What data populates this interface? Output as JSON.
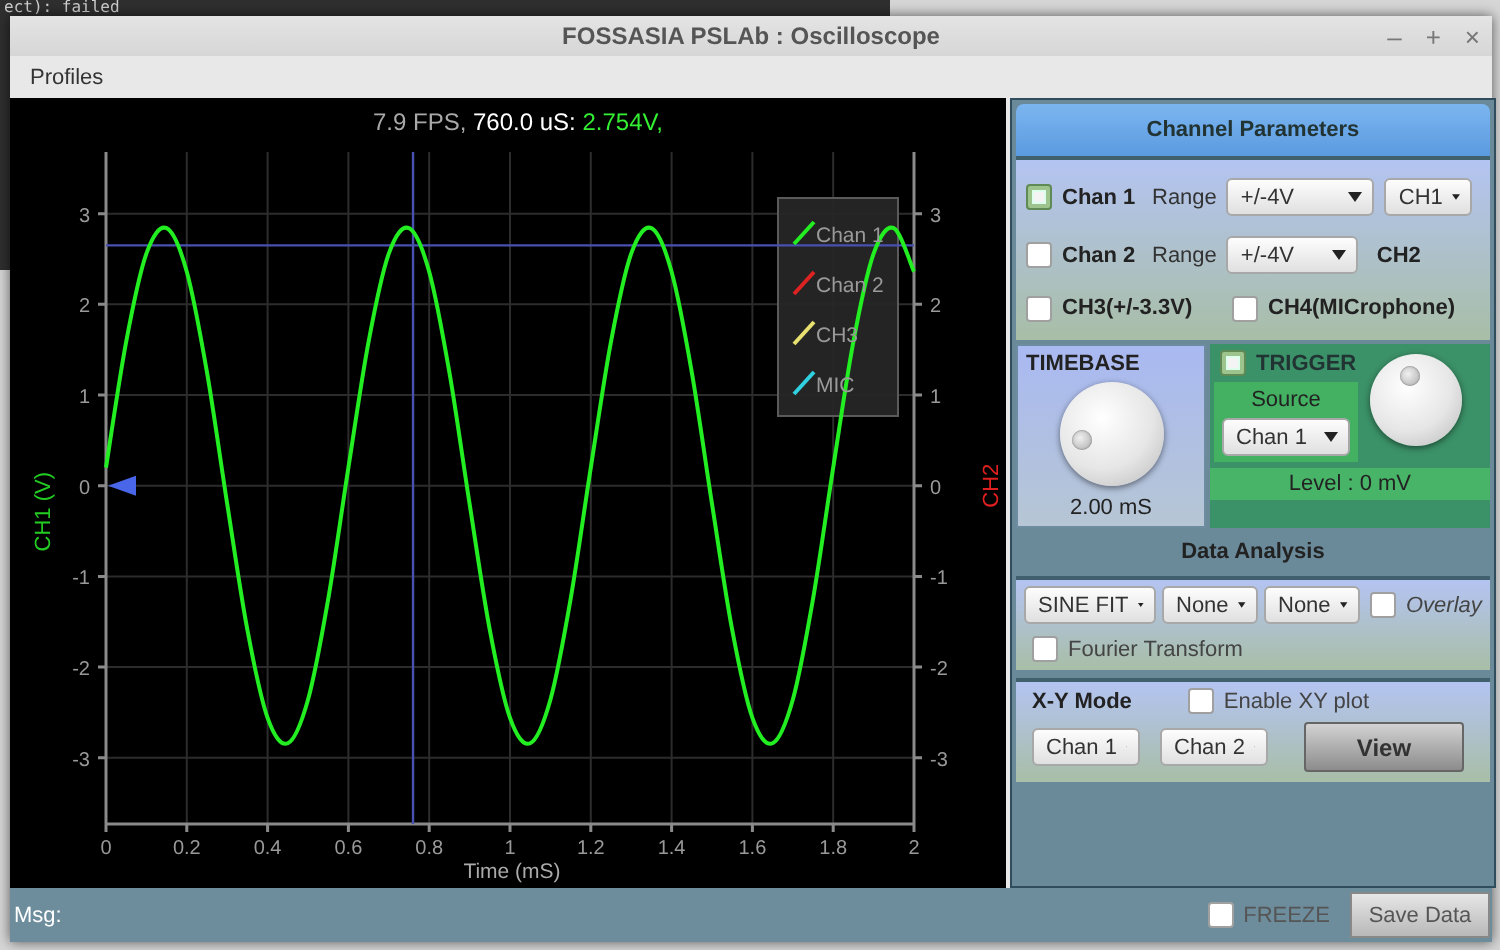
{
  "background_terminal": {
    "text": "ect): failed"
  },
  "window": {
    "title": "FOSSASIA PSLAb : Oscilloscope",
    "controls": [
      "–",
      "+",
      "×"
    ]
  },
  "menu": [
    "Profiles"
  ],
  "plot": {
    "readout": [
      {
        "text": "7.9 FPS,",
        "kind": "info"
      },
      {
        "text": "760.0 uS:",
        "kind": "time"
      },
      {
        "text": "2.754V,",
        "kind": "voltage"
      }
    ],
    "right_axis": {
      "label": "CH2",
      "ticks": [
        "3",
        "2",
        "1",
        "0",
        "-1",
        "-2",
        "-3"
      ]
    },
    "legend": [
      {
        "label": "Chan 2",
        "color": "#dd2222"
      },
      {
        "label": "CH3",
        "color": "#e8e070"
      },
      {
        "label": "MIC",
        "color": "#30d0e0"
      }
    ],
    "chart_data": {
      "type": "line",
      "xlabel": "Time (mS)",
      "ylabel": "CH1 (V)",
      "x": [
        0,
        0.05,
        0.1,
        0.15,
        0.2,
        0.25,
        0.3,
        0.35,
        0.4,
        0.45,
        0.5,
        0.55,
        0.6,
        0.65,
        0.7,
        0.75,
        0.8,
        0.85,
        0.9,
        0.95,
        1,
        1.05,
        1.1,
        1.15,
        1.2,
        1.25,
        1.3,
        1.35,
        1.4,
        1.45,
        1.5,
        1.55,
        1.6,
        1.65,
        1.7,
        1.75,
        1.8,
        1.85,
        1.9,
        1.95,
        2
      ],
      "series": [
        {
          "name": "Chan 1",
          "color": "#22ee22",
          "values": [
            0.2,
            1.59,
            2.56,
            2.84,
            2.36,
            1.25,
            -0.2,
            -1.59,
            -2.56,
            -2.84,
            -2.36,
            -1.25,
            0.2,
            1.59,
            2.56,
            2.84,
            2.36,
            1.25,
            -0.2,
            -1.59,
            -2.56,
            -2.84,
            -2.36,
            -1.25,
            0.2,
            1.59,
            2.56,
            2.84,
            2.36,
            1.25,
            -0.2,
            -1.59,
            -2.56,
            -2.84,
            -2.36,
            -1.25,
            0.2,
            1.59,
            2.56,
            2.84,
            2.36
          ]
        }
      ],
      "xlim": [
        0,
        2
      ],
      "ylim": [
        -3.73,
        3.68
      ],
      "xticks": [
        0,
        {
          "value": 0.2,
          "label": "0.2"
        },
        {
          "value": 0.4,
          "label": "0.4"
        },
        {
          "value": 0.6,
          "label": "0.6"
        },
        {
          "value": 0.8,
          "label": "0.8"
        },
        1,
        {
          "value": 1.2,
          "label": "1.2"
        },
        {
          "value": 1.4,
          "label": "1.4"
        },
        {
          "value": 1.6,
          "label": "1.6"
        },
        {
          "value": 1.8,
          "label": "1.8"
        },
        2
      ],
      "yticks": [
        -3,
        -2,
        -1,
        0,
        1,
        2,
        3
      ],
      "grid": true,
      "ref_lines": [
        {
          "axis": "x",
          "value": 0.76
        },
        {
          "axis": "y",
          "value": 2.65
        }
      ]
    }
  },
  "panel": {
    "title": "Channel Parameters",
    "channels": [
      {
        "label": "Chan 1",
        "checked": true,
        "range_label": "Range",
        "range": "+/-4V",
        "target": {
          "kind": "dropdown",
          "text": "CH1"
        }
      },
      {
        "label": "Chan 2",
        "checked": false,
        "range_label": "Range",
        "range": "+/-4V",
        "target": {
          "kind": "text",
          "text": "CH2"
        }
      }
    ],
    "extra_channels": [
      {
        "label": "CH3(+/-3.3V)",
        "checked": false
      },
      {
        "label": "CH4(MICrophone)",
        "checked": false
      }
    ],
    "timebase": {
      "title": "TIMEBASE",
      "level": 0.13,
      "reading": "2.00 mS"
    },
    "trigger": {
      "title": "TRIGGER",
      "checked": true,
      "source_label": "Source",
      "source": "Chan 1",
      "level": 0.44,
      "reading": "Level : 0 mV"
    },
    "analysis": {
      "title": "Data Analysis",
      "selects": [
        "SINE FIT",
        "None",
        "None"
      ],
      "overlay": {
        "label": "Overlay",
        "checked": false
      },
      "fourier": {
        "label": "Fourier Transform",
        "checked": false
      }
    },
    "xy": {
      "title": "X-Y Mode",
      "enable": {
        "label": "Enable XY plot",
        "checked": false
      },
      "selects": [
        "Chan 1",
        "Chan 2"
      ],
      "button": "View"
    }
  },
  "status_bar": {
    "label": "Msg:",
    "freeze": {
      "label": "FREEZE",
      "checked": false
    },
    "button": "Save Data"
  }
}
